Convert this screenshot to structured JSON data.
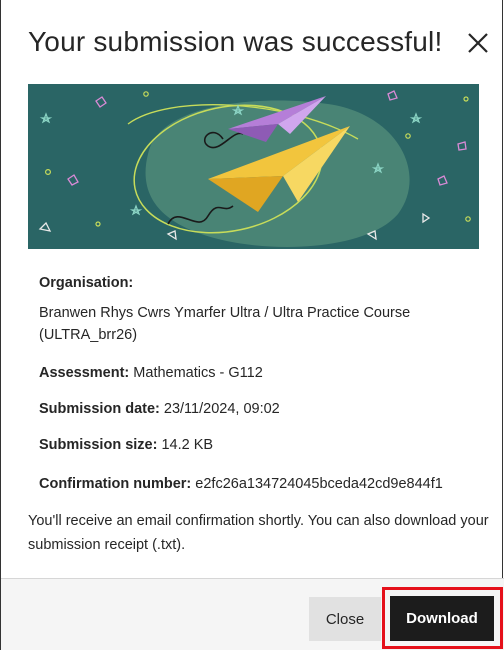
{
  "dialog": {
    "title": "Your submission was successful!",
    "close_icon": "close-icon"
  },
  "banner": {
    "icon": "paper-planes-illustration",
    "background_color": "#2a6565"
  },
  "details": {
    "organisation_label": "Organisation:",
    "organisation_value": "Branwen Rhys Cwrs Ymarfer Ultra / Ultra Practice Course (ULTRA_brr26)",
    "assessment_label": "Assessment:",
    "assessment_value": "Mathematics - G112",
    "submission_date_label": "Submission date:",
    "submission_date_value": "23/11/2024, 09:02",
    "submission_size_label": "Submission size:",
    "submission_size_value": "14.2 KB",
    "confirmation_label": "Confirmation number:",
    "confirmation_value": "e2fc26a134724045bceda42cd9e844f1"
  },
  "note": "You'll receive an email confirmation shortly. You can also download your submission receipt (.txt).",
  "footer": {
    "close_label": "Close",
    "download_label": "Download",
    "highlight_color": "#e5101a"
  }
}
